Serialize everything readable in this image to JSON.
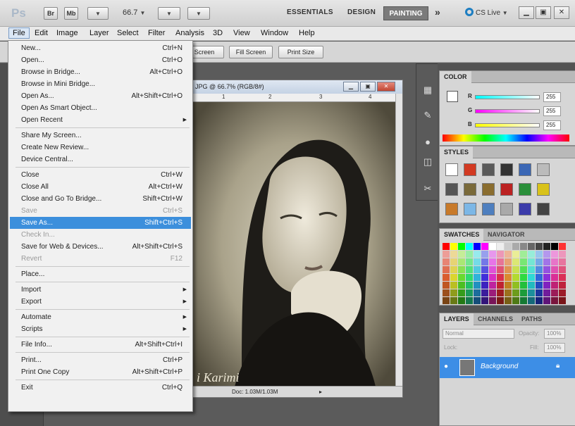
{
  "appbar": {
    "logo": "Ps",
    "br": "Br",
    "mb": "Mb",
    "zoom": "66.7",
    "workspaces": [
      "ESSENTIALS",
      "DESIGN",
      "PAINTING"
    ],
    "more": "»",
    "cslive": "CS Live"
  },
  "menubar": [
    "File",
    "Edit",
    "Image",
    "Layer",
    "Select",
    "Filter",
    "Analysis",
    "3D",
    "View",
    "Window",
    "Help"
  ],
  "options": [
    "Screen",
    "Fill Screen",
    "Print Size"
  ],
  "document": {
    "title": "JPG @ 66.7% (RGB/8#)",
    "ruler": [
      "1",
      "2",
      "3",
      "4"
    ],
    "signature": "i Karimi",
    "doc_info": "Doc: 1.03M/1.03M"
  },
  "color_panel": {
    "tab": "COLOR",
    "r_label": "R",
    "g_label": "G",
    "b_label": "B",
    "r": "255",
    "g": "255",
    "b": "255"
  },
  "styles_panel": {
    "tab": "STYLES"
  },
  "swatches_panel": {
    "tabs": [
      "SWATCHES",
      "NAVIGATOR"
    ]
  },
  "layers_panel": {
    "tabs": [
      "LAYERS",
      "CHANNELS",
      "PATHS"
    ],
    "blend": "Normal",
    "opacity_label": "Opacity:",
    "opacity": "100%",
    "lock_label": "Lock:",
    "fill_label": "Fill:",
    "fill": "100%",
    "layer_name": "Background"
  },
  "file_menu": [
    {
      "label": "New...",
      "sc": "Ctrl+N"
    },
    {
      "label": "Open...",
      "sc": "Ctrl+O"
    },
    {
      "label": "Browse in Bridge...",
      "sc": "Alt+Ctrl+O"
    },
    {
      "label": "Browse in Mini Bridge...",
      "sc": ""
    },
    {
      "label": "Open As...",
      "sc": "Alt+Shift+Ctrl+O"
    },
    {
      "label": "Open As Smart Object...",
      "sc": ""
    },
    {
      "label": "Open Recent",
      "sc": ""
    },
    {
      "label": "Share My Screen...",
      "sc": ""
    },
    {
      "label": "Create New Review...",
      "sc": ""
    },
    {
      "label": "Device Central...",
      "sc": ""
    },
    {
      "label": "Close",
      "sc": "Ctrl+W"
    },
    {
      "label": "Close All",
      "sc": "Alt+Ctrl+W"
    },
    {
      "label": "Close and Go To Bridge...",
      "sc": "Shift+Ctrl+W"
    },
    {
      "label": "Save",
      "sc": "Ctrl+S"
    },
    {
      "label": "Save As...",
      "sc": "Shift+Ctrl+S"
    },
    {
      "label": "Check In...",
      "sc": ""
    },
    {
      "label": "Save for Web & Devices...",
      "sc": "Alt+Shift+Ctrl+S"
    },
    {
      "label": "Revert",
      "sc": "F12"
    },
    {
      "label": "Place...",
      "sc": ""
    },
    {
      "label": "Import",
      "sc": ""
    },
    {
      "label": "Export",
      "sc": ""
    },
    {
      "label": "Automate",
      "sc": ""
    },
    {
      "label": "Scripts",
      "sc": ""
    },
    {
      "label": "File Info...",
      "sc": "Alt+Shift+Ctrl+I"
    },
    {
      "label": "Print...",
      "sc": "Ctrl+P"
    },
    {
      "label": "Print One Copy",
      "sc": "Alt+Shift+Ctrl+P"
    },
    {
      "label": "Exit",
      "sc": "Ctrl+Q"
    }
  ]
}
